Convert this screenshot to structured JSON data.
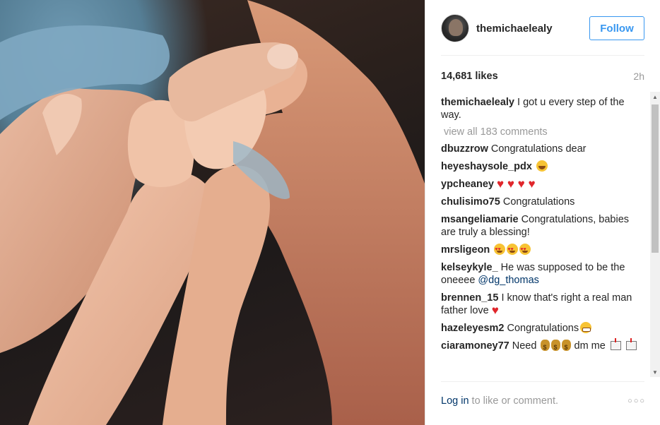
{
  "post": {
    "username": "themichaelealy",
    "follow_label": "Follow",
    "likes": "14,681 likes",
    "time": "2h",
    "caption": {
      "user": "themichaelealy",
      "text": "I got u every step of the way."
    },
    "view_all": "view all 183 comments",
    "comments": [
      {
        "user": "dbuzzrow",
        "text": "Congratulations dear"
      },
      {
        "user": "heyeshaysole_pdx",
        "text": "",
        "emoji": "smile-icon"
      },
      {
        "user": "ypcheaney",
        "text": "",
        "hearts": "♥ ♥ ♥ ♥"
      },
      {
        "user": "chulisimo75",
        "text": "Congratulations"
      },
      {
        "user": "msangeliamarie",
        "text": "Congratulations, babies are truly a blessing!"
      },
      {
        "user": "mrsligeon",
        "text": "",
        "emoji": "heart-eyes-icon"
      },
      {
        "user": "kelseykyle_",
        "text": "He was supposed to be the oneeee",
        "mention": "@dg_thomas"
      },
      {
        "user": "brennen_15",
        "text": "I know that's right a real man father love",
        "hearts": "♥"
      },
      {
        "user": "hazeleyesm2",
        "text": "Congratulations",
        "emoji": "grin-icon"
      },
      {
        "user": "ciaramoney77",
        "text": "Need",
        "text2": "dm me"
      }
    ],
    "footer": {
      "login": "Log in",
      "rest": " to like or comment.",
      "more": "○○○"
    }
  },
  "colors": {
    "accent": "#3897f0",
    "link": "#003569",
    "muted": "#999999",
    "heart": "#e0262b"
  }
}
